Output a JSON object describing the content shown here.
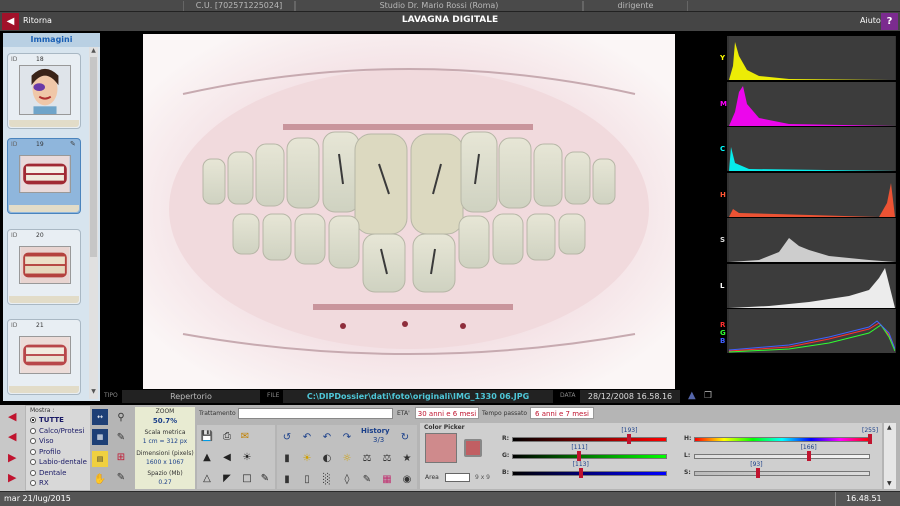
{
  "topbar": {
    "code": "C.U. [702571225024]",
    "studio": "Studio Dr. Mario Rossi (Roma)",
    "role": "dirigente"
  },
  "titlebar": {
    "back_label": "Ritorna",
    "title": "LAVAGNA DIGITALE",
    "help_label": "Aiuto",
    "help_icon": "?"
  },
  "sidebar": {
    "header": "Immagini",
    "id_label": "ID",
    "items": [
      {
        "id": "18"
      },
      {
        "id": "19"
      },
      {
        "id": "20"
      },
      {
        "id": "21"
      }
    ]
  },
  "histograms": {
    "channels": [
      {
        "label": "Y",
        "color": "#ffff00"
      },
      {
        "label": "M",
        "color": "#ff00ff"
      },
      {
        "label": "C",
        "color": "#00ffff"
      },
      {
        "label": "H",
        "color": "#ff5533"
      },
      {
        "label": "S",
        "color": "#dddddd"
      },
      {
        "label": "L",
        "color": "#ffffff"
      }
    ],
    "rgb_labels": [
      "R",
      "G",
      "B"
    ]
  },
  "filerow": {
    "tipo_label": "TIPO",
    "tipo_value": "Repertorio",
    "file_label": "FILE",
    "file_value": "C:\\DIPDossier\\dati\\foto\\originali\\IMG_1330 06.JPG",
    "data_label": "DATA",
    "data_value": "28/12/2008 16.58.16"
  },
  "filter": {
    "title": "Mostra :",
    "options": [
      "TUTTE",
      "Calco/Protesi",
      "Viso",
      "Profilo",
      "Labio-dentale",
      "Dentale",
      "RX"
    ],
    "selected": 0
  },
  "zoom": {
    "zoom_label": "ZOOM",
    "zoom_value": "50.7%",
    "scale_label": "Scala metrica",
    "scale_value": "1 cm = 312 px",
    "dim_label": "Dimensioni (pixels)",
    "dim_value": "1600 x 1067",
    "space_label": "Spazio (Mb)",
    "space_value": "0.27"
  },
  "treatment": {
    "label": "Trattamento",
    "value": "",
    "age_label": "ETA'",
    "age_value": "30 anni e 6 mesi",
    "elapsed_label": "Tempo passato",
    "elapsed_value": "6 anni e 7 mesi"
  },
  "history": {
    "label": "History",
    "count": "3/3"
  },
  "color_picker": {
    "title": "Color Picker",
    "area_label": "Area",
    "area_value": "9 x 9",
    "sliders": [
      {
        "label": "R:",
        "value": "193",
        "fraction": 0.757
      },
      {
        "label": "G:",
        "value": "111",
        "fraction": 0.435
      },
      {
        "label": "B:",
        "value": "113",
        "fraction": 0.443
      },
      {
        "label": "H:",
        "value": "255",
        "fraction": 1.0
      },
      {
        "label": "L:",
        "value": "166",
        "fraction": 0.651
      },
      {
        "label": "S:",
        "value": "93",
        "fraction": 0.365
      }
    ],
    "swatch": "#c15f63"
  },
  "status": {
    "date": "mar 21/lug/2015",
    "time": "16.48.51"
  }
}
